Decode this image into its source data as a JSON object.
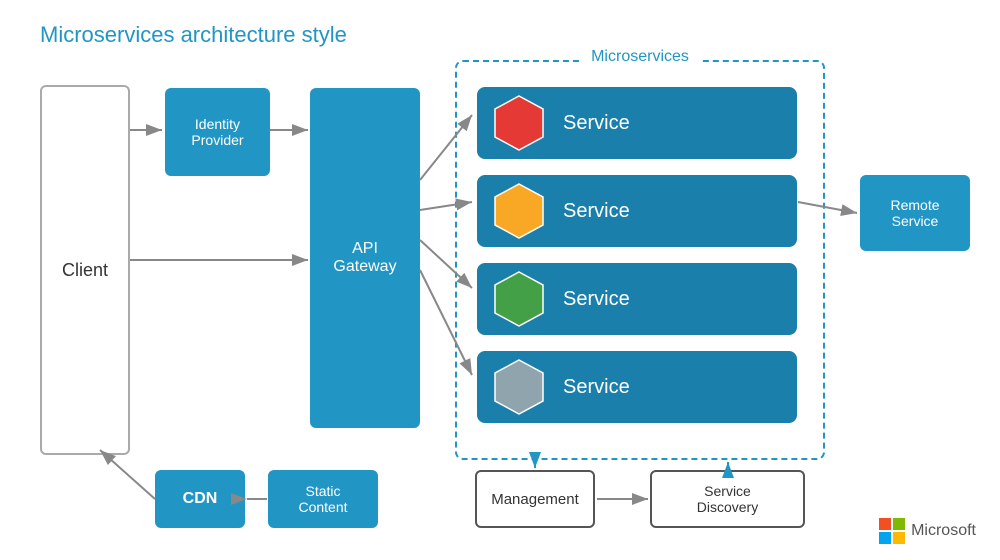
{
  "title": "Microservices architecture style",
  "client": {
    "label": "Client"
  },
  "identity_provider": {
    "label": "Identity\nProvider",
    "line1": "Identity",
    "line2": "Provider"
  },
  "api_gateway": {
    "label": "API\nGateway",
    "line1": "API",
    "line2": "Gateway"
  },
  "microservices": {
    "title": "Microservices",
    "services": [
      {
        "label": "Service",
        "hex_color": "#e53935"
      },
      {
        "label": "Service",
        "hex_color": "#f9a825"
      },
      {
        "label": "Service",
        "hex_color": "#43a047"
      },
      {
        "label": "Service",
        "hex_color": "#90a4ae"
      }
    ]
  },
  "remote_service": {
    "line1": "Remote",
    "line2": "Service"
  },
  "cdn": {
    "label": "CDN"
  },
  "static_content": {
    "line1": "Static",
    "line2": "Content"
  },
  "management": {
    "label": "Management"
  },
  "service_discovery": {
    "line1": "Service",
    "line2": "Discovery"
  },
  "microsoft": {
    "label": "Microsoft"
  }
}
